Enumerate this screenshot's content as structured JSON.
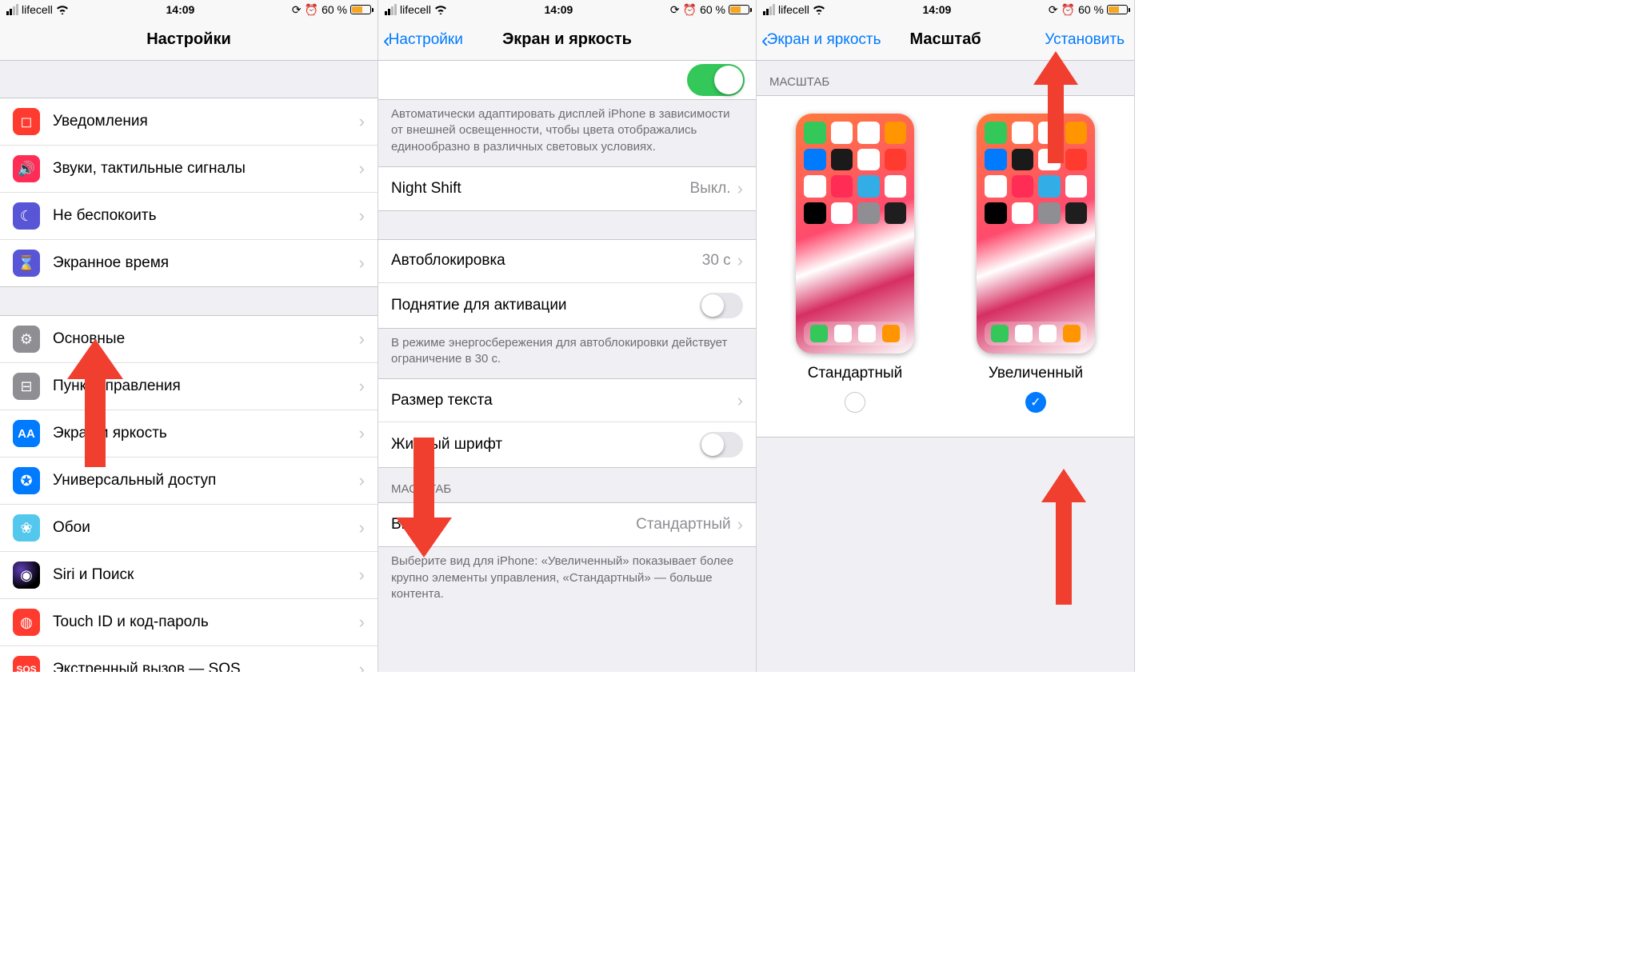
{
  "status": {
    "carrier": "lifecell",
    "time": "14:09",
    "battery_percent": "60 %",
    "alarm_glyph": "⏰",
    "loop_glyph": "⟳"
  },
  "panel1": {
    "title": "Настройки",
    "group1": [
      {
        "icon_class": "ic-red",
        "glyph": "◻",
        "label": "Уведомления"
      },
      {
        "icon_class": "ic-pink",
        "glyph": "🔊",
        "label": "Звуки, тактильные сигналы"
      },
      {
        "icon_class": "ic-purple",
        "glyph": "☾",
        "label": "Не беспокоить"
      },
      {
        "icon_class": "ic-purple",
        "glyph": "⌛",
        "label": "Экранное время"
      }
    ],
    "group2": [
      {
        "icon_class": "ic-set",
        "glyph": "⚙",
        "label": "Основные"
      },
      {
        "icon_class": "ic-gray",
        "glyph": "⊟",
        "label": "Пункт управления"
      },
      {
        "icon_class": "ic-aa",
        "glyph": "AA",
        "label": "Экран и яркость"
      },
      {
        "icon_class": "ic-blue",
        "glyph": "✪",
        "label": "Универсальный доступ"
      },
      {
        "icon_class": "ic-wall",
        "glyph": "❀",
        "label": "Обои"
      },
      {
        "icon_class": "ic-black",
        "glyph": "◉",
        "label": "Siri и Поиск"
      },
      {
        "icon_class": "ic-red",
        "glyph": "◍",
        "label": "Touch ID и код-пароль"
      },
      {
        "icon_class": "ic-red",
        "glyph": "SOS",
        "label": "Экстренный вызов — SOS",
        "small": true
      }
    ]
  },
  "panel2": {
    "back": "Настройки",
    "title": "Экран и яркость",
    "true_tone_footer": "Автоматически адаптировать дисплей iPhone в зависимости от внешней освещенности, чтобы цвета отображались единообразно в различных световых условиях.",
    "night_shift": {
      "label": "Night Shift",
      "value": "Выкл."
    },
    "autolock": {
      "label": "Автоблокировка",
      "value": "30 с"
    },
    "raise": {
      "label": "Поднятие для активации"
    },
    "powersave_footer": "В режиме энергосбережения для автоблокировки действует ограничение в 30 с.",
    "text_size": {
      "label": "Размер текста"
    },
    "bold": {
      "label": "Жирный шрифт"
    },
    "zoom_header": "МАСШТАБ",
    "view": {
      "label": "Вид",
      "value": "Стандартный"
    },
    "view_footer": "Выберите вид для iPhone: «Увеличенный» показывает более крупно элементы управления, «Стандартный» — больше контента."
  },
  "panel3": {
    "back": "Экран и яркость",
    "title": "Масштаб",
    "set": "Установить",
    "zoom_header": "МАСШТАБ",
    "standard": "Стандартный",
    "zoomed": "Увеличенный"
  },
  "app_colors": [
    "#34C759",
    "#fff",
    "#fff",
    "#FF9500",
    "#007AFF",
    "#1A1A1A",
    "#fff",
    "#FF3B30",
    "#fff",
    "#FF2D55",
    "#32ADE6",
    "#fff",
    "#000",
    "#fff",
    "#8E8E93",
    "#1e1e1e"
  ],
  "dock_colors": [
    "#34C759",
    "#fff",
    "#fff",
    "#FF9500"
  ]
}
